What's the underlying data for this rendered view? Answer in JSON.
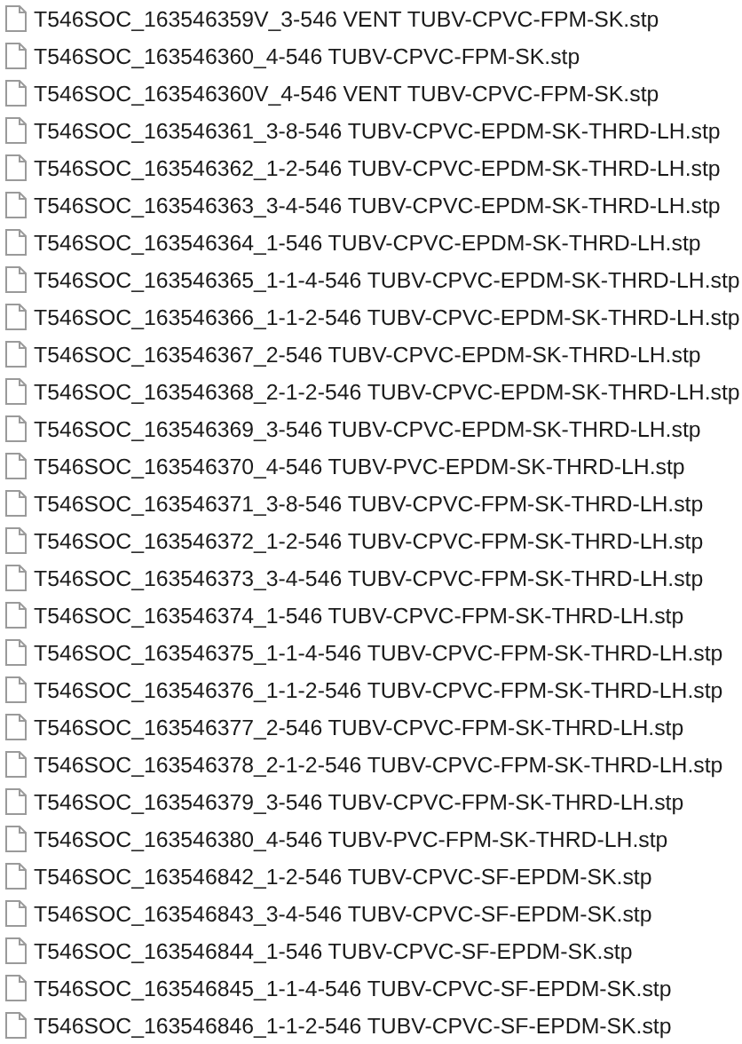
{
  "files": [
    {
      "name": "T546SOC_163546359V_3-546 VENT TUBV-CPVC-FPM-SK.stp"
    },
    {
      "name": "T546SOC_163546360_4-546 TUBV-CPVC-FPM-SK.stp"
    },
    {
      "name": "T546SOC_163546360V_4-546 VENT TUBV-CPVC-FPM-SK.stp"
    },
    {
      "name": "T546SOC_163546361_3-8-546 TUBV-CPVC-EPDM-SK-THRD-LH.stp"
    },
    {
      "name": "T546SOC_163546362_1-2-546 TUBV-CPVC-EPDM-SK-THRD-LH.stp"
    },
    {
      "name": "T546SOC_163546363_3-4-546 TUBV-CPVC-EPDM-SK-THRD-LH.stp"
    },
    {
      "name": "T546SOC_163546364_1-546 TUBV-CPVC-EPDM-SK-THRD-LH.stp"
    },
    {
      "name": "T546SOC_163546365_1-1-4-546 TUBV-CPVC-EPDM-SK-THRD-LH.stp"
    },
    {
      "name": "T546SOC_163546366_1-1-2-546 TUBV-CPVC-EPDM-SK-THRD-LH.stp"
    },
    {
      "name": "T546SOC_163546367_2-546 TUBV-CPVC-EPDM-SK-THRD-LH.stp"
    },
    {
      "name": "T546SOC_163546368_2-1-2-546 TUBV-CPVC-EPDM-SK-THRD-LH.stp"
    },
    {
      "name": "T546SOC_163546369_3-546 TUBV-CPVC-EPDM-SK-THRD-LH.stp"
    },
    {
      "name": "T546SOC_163546370_4-546 TUBV-PVC-EPDM-SK-THRD-LH.stp"
    },
    {
      "name": "T546SOC_163546371_3-8-546 TUBV-CPVC-FPM-SK-THRD-LH.stp"
    },
    {
      "name": "T546SOC_163546372_1-2-546 TUBV-CPVC-FPM-SK-THRD-LH.stp"
    },
    {
      "name": "T546SOC_163546373_3-4-546 TUBV-CPVC-FPM-SK-THRD-LH.stp"
    },
    {
      "name": "T546SOC_163546374_1-546 TUBV-CPVC-FPM-SK-THRD-LH.stp"
    },
    {
      "name": "T546SOC_163546375_1-1-4-546 TUBV-CPVC-FPM-SK-THRD-LH.stp"
    },
    {
      "name": "T546SOC_163546376_1-1-2-546 TUBV-CPVC-FPM-SK-THRD-LH.stp"
    },
    {
      "name": "T546SOC_163546377_2-546 TUBV-CPVC-FPM-SK-THRD-LH.stp"
    },
    {
      "name": "T546SOC_163546378_2-1-2-546 TUBV-CPVC-FPM-SK-THRD-LH.stp"
    },
    {
      "name": "T546SOC_163546379_3-546 TUBV-CPVC-FPM-SK-THRD-LH.stp"
    },
    {
      "name": "T546SOC_163546380_4-546 TUBV-PVC-FPM-SK-THRD-LH.stp"
    },
    {
      "name": "T546SOC_163546842_1-2-546 TUBV-CPVC-SF-EPDM-SK.stp"
    },
    {
      "name": "T546SOC_163546843_3-4-546 TUBV-CPVC-SF-EPDM-SK.stp"
    },
    {
      "name": "T546SOC_163546844_1-546 TUBV-CPVC-SF-EPDM-SK.stp"
    },
    {
      "name": "T546SOC_163546845_1-1-4-546 TUBV-CPVC-SF-EPDM-SK.stp"
    },
    {
      "name": "T546SOC_163546846_1-1-2-546 TUBV-CPVC-SF-EPDM-SK.stp"
    }
  ]
}
